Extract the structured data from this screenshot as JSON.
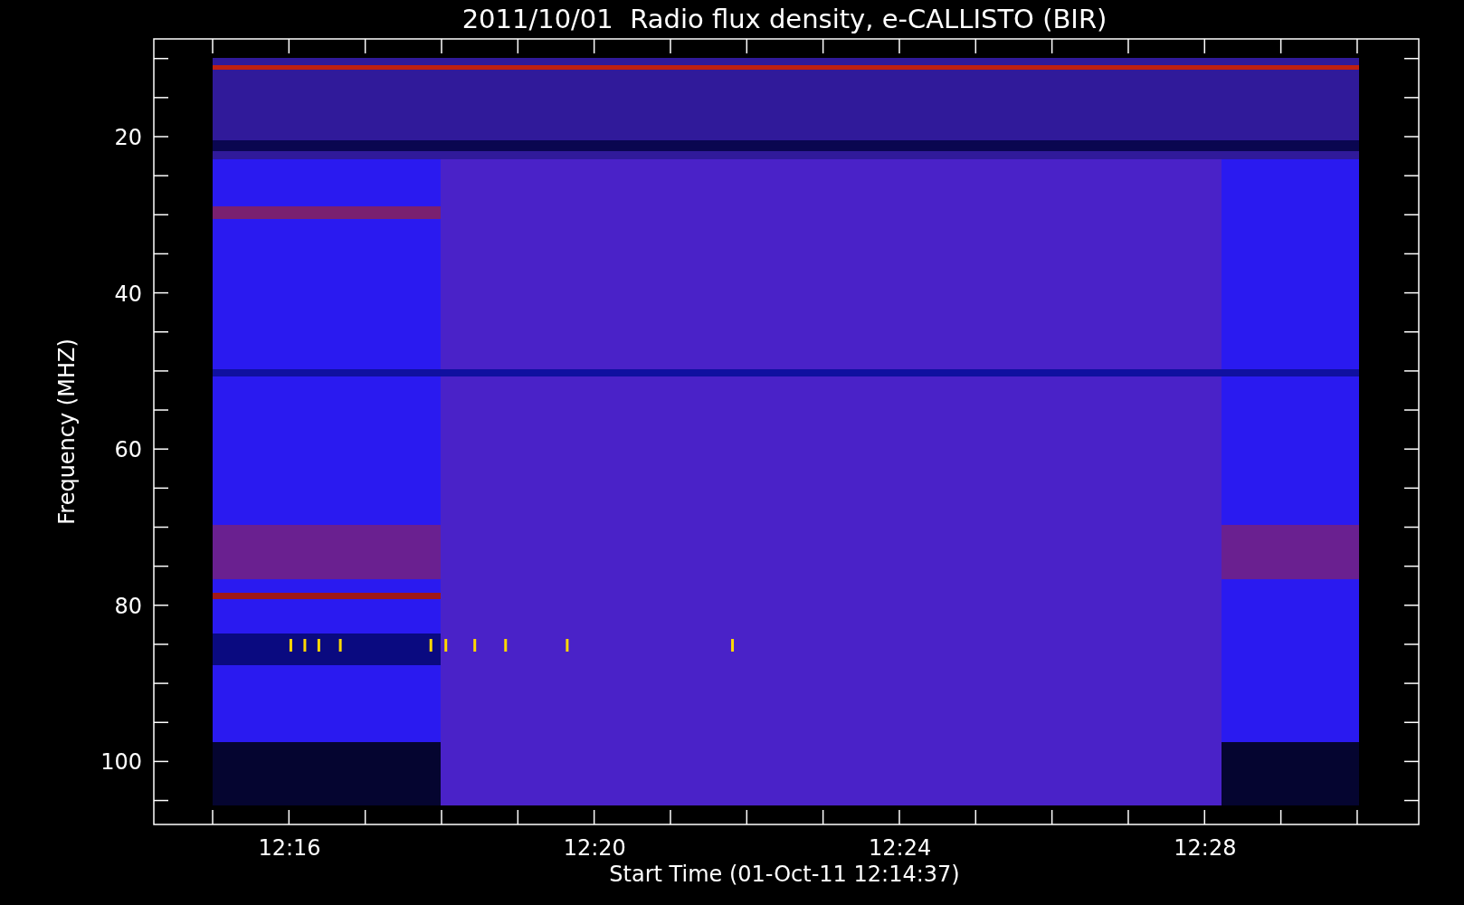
{
  "title": "2011/10/01  Radio flux density, e-CALLISTO (BIR)",
  "y_axis": {
    "label": "Frequency (MHZ)",
    "ticks": [
      "20",
      "40",
      "60",
      "80",
      "100"
    ]
  },
  "x_axis": {
    "label": "Start Time (01-Oct-11 12:14:37)",
    "ticks": [
      "12:16",
      "12:20",
      "12:24",
      "12:28"
    ]
  }
}
